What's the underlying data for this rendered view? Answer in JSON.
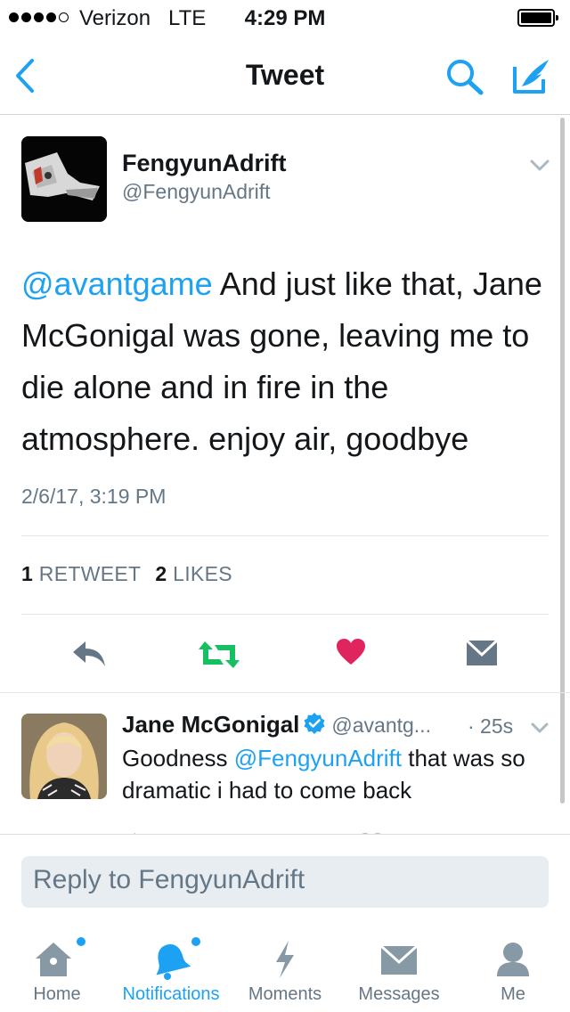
{
  "status_bar": {
    "carrier": "Verizon",
    "network": "LTE",
    "time": "4:29 PM"
  },
  "nav": {
    "title": "Tweet",
    "back_icon": "chevron-left-icon",
    "search_icon": "search-icon",
    "compose_icon": "compose-icon"
  },
  "tweet": {
    "author_name": "FengyunAdrift",
    "author_handle": "@FengyunAdrift",
    "mention": "@avantgame",
    "body": " And just like that, Jane McGonigal was gone, leaving me to die alone and in fire in the atmosphere. enjoy air, goodbye",
    "timestamp": "2/6/17, 3:19 PM",
    "retweet_count": "1",
    "retweet_label": "RETWEET",
    "like_count": "2",
    "like_label": "LIKES"
  },
  "reply": {
    "name": "Jane McGonigal",
    "handle": "@avantg...",
    "time": "· 25s",
    "text_before": "Goodness ",
    "mention": "@FengyunAdrift",
    "text_after": " that was so dramatic i had to come back"
  },
  "reply_box": {
    "placeholder": "Reply to FengyunAdrift"
  },
  "tabs": [
    {
      "label": "Home",
      "icon": "home-icon"
    },
    {
      "label": "Notifications",
      "icon": "bell-icon"
    },
    {
      "label": "Moments",
      "icon": "lightning-icon"
    },
    {
      "label": "Messages",
      "icon": "envelope-icon"
    },
    {
      "label": "Me",
      "icon": "person-icon"
    }
  ],
  "colors": {
    "accent": "#1da1f2",
    "retweet": "#17bf63",
    "like": "#e0245e",
    "secondary": "#657786",
    "icon_gray": "#8899a6"
  }
}
